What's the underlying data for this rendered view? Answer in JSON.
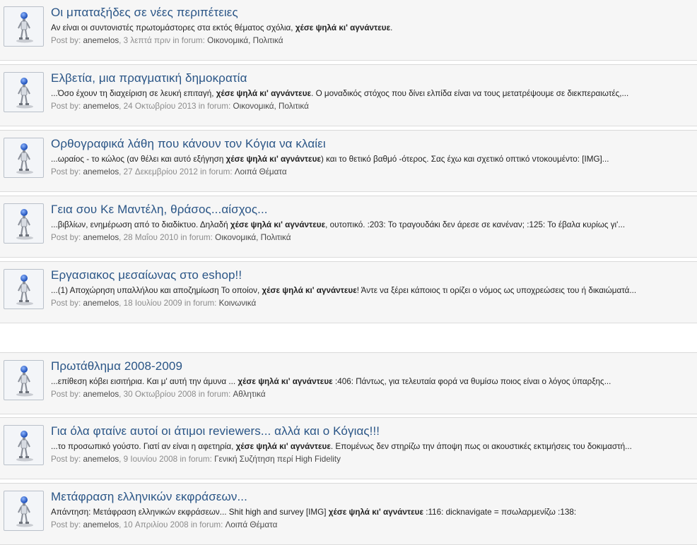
{
  "labels": {
    "post_by": "Post by:",
    "in_forum": "in forum:"
  },
  "results": [
    {
      "title": "Οι μπαταξήδες σε νέες περιπέτειες",
      "snippet_before": "Αν είναι οι συντονιστές πρωτομάστορες στα εκτός θέματος σχόλια, ",
      "snippet_bold": "χέσε ψηλά κι' αγνάντευε",
      "snippet_after": ".",
      "user": "anemelos",
      "date": "3 λεπτά πριν",
      "forum": "Οικονομικά, Πολιτικά"
    },
    {
      "title": "Ελβετία, μια πραγματική δημοκρατία",
      "snippet_before": "...Όσο έχουν τη διαχείριση σε λευκή επιταγή, ",
      "snippet_bold": "χέσε ψηλά κι' αγνάντευε",
      "snippet_after": ". Ο μοναδικός στόχος που δίνει ελπίδα είναι να τους μετατρέψουμε σε διεκπεραιωτές,...",
      "user": "anemelos",
      "date": "24 Οκτωβρίου 2013",
      "forum": "Οικονομικά, Πολιτικά"
    },
    {
      "title": "Ορθογραφικά λάθη που κάνουν τον Κόγια να κλαίει",
      "snippet_before": "...ωραίος - το κώλος (αν θέλει και αυτό εξήγηση ",
      "snippet_bold": "χέσε ψηλά κι' αγνάντευε",
      "snippet_after": ") και το θετικό βαθμό -ότερος. Σας έχω και σχετικό οπτικό ντοκουμέντο: [IMG]...",
      "user": "anemelos",
      "date": "27 Δεκεμβρίου 2012",
      "forum": "Λοιπά Θέματα"
    },
    {
      "title": "Γεια σου Κε Μαντέλη, θράσος...αίσχος...",
      "snippet_before": "...βιβλίων, ενημέρωση από το διαδίκτυο. Δηλαδή ",
      "snippet_bold": "χέσε ψηλά κι' αγνάντευε",
      "snippet_after": ", ουτοπικό. :203: Το τραγουδάκι δεν άρεσε σε κανέναν; :125: Το έβαλα κυρίως γι'...",
      "user": "anemelos",
      "date": "28 Μαΐου 2010",
      "forum": "Οικονομικά, Πολιτικά"
    },
    {
      "title": "Εργασιακος μεσαίωνας στο eshop!!",
      "snippet_before": "...(1) Αποχώρηση υπαλλήλου και αποζημίωση Το οποίον, ",
      "snippet_bold": "χέσε ψηλά κι' αγνάντευε",
      "snippet_after": "! Άντε να ξέρει κάποιος τι ορίζει ο νόμος ως υποχρεώσεις του ή δικαιώματά...",
      "user": "anemelos",
      "date": "18 Ιουλίου 2009",
      "forum": "Κοινωνικά"
    },
    {
      "title": "Πρωτάθλημα 2008-2009",
      "snippet_before": "...επίθεση κόβει εισιτήρια. Και μ' αυτή την άμυνα ... ",
      "snippet_bold": "χέσε ψηλά κι' αγνάντευε",
      "snippet_after": " :406: Πάντως, για τελευταία φορά να θυμίσω ποιος είναι ο λόγος ύπαρξης...",
      "user": "anemelos",
      "date": "30 Οκτωβρίου 2008",
      "forum": "Αθλητικά"
    },
    {
      "title": "Για όλα φταίνε αυτοί οι άτιμοι reviewers... αλλά και ο Κόγιας!!!",
      "snippet_before": "...το προσωπικό γούστο. Γιατί αν είναι η αφετηρία, ",
      "snippet_bold": "χέσε ψηλά κι' αγνάντευε",
      "snippet_after": ". Επομένως δεν στηρίζω την άποψη πως οι ακουστικές εκτιμήσεις του δοκιμαστή...",
      "user": "anemelos",
      "date": "9 Ιουνίου 2008",
      "forum": "Γενική Συζήτηση περί High Fidelity"
    },
    {
      "title": "Μετάφραση ελληνικών εκφράσεων...",
      "snippet_before": "Απάντηση: Μετάφραση ελληνικών εκφράσεων... Shit high and survey [IMG] ",
      "snippet_bold": "χέσε ψηλά κι' αγνάντευε",
      "snippet_after": " :116: dicknavigate = πσωλαρμενίζω :138:",
      "user": "anemelos",
      "date": "10 Απριλίου 2008",
      "forum": "Λοιπά Θέματα"
    }
  ]
}
